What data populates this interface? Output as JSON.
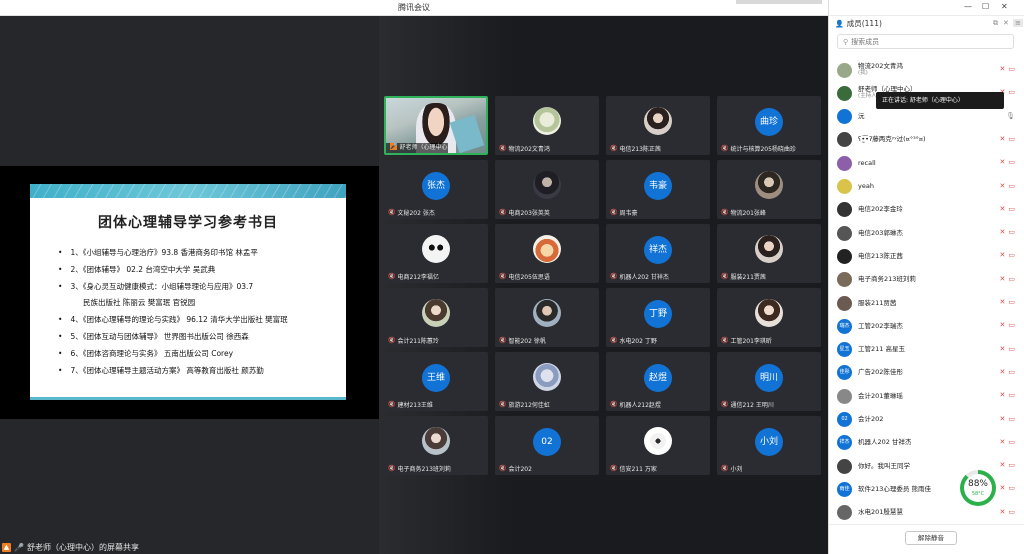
{
  "window": {
    "title": "腾讯会议"
  },
  "share": {
    "slide": {
      "title": "团体心理辅导学习参考书目",
      "items": [
        {
          "text": "1、《小组辅导与心理治疗》93.8 香港商务印书馆 林孟平"
        },
        {
          "text": "2、《团体辅导》 02.2 台湾空中大学 吴武典"
        },
        {
          "text": "3、《身心灵互动健康模式：小组辅导理论与应用》03.7",
          "sub": "民族出版社 陈丽云 樊富珉 官锐园"
        },
        {
          "text": "4、《团体心理辅导的理论与实践》 96.12 清华大学出版社 樊富珉"
        },
        {
          "text": "5、《团体互动与团体辅导》 世界图书出版公司 徐西森"
        },
        {
          "text": "6、《团体咨商理论与实务》 五南出版公司 Corey"
        },
        {
          "text": "7、《团体心理辅导主题活动方案》 高等教育出版社 颜苏勤"
        }
      ]
    },
    "status_text": "舒老师（心理中心）的屏幕共享"
  },
  "tiles": [
    {
      "name": "舒老师（心理中心）",
      "type": "video",
      "active": true
    },
    {
      "name": "物流202文青鸿",
      "type": "image",
      "avatar": "plant"
    },
    {
      "name": "电信213陈正茜",
      "type": "image",
      "avatar": "girl"
    },
    {
      "name": "统计与核算205杨晓曲珍",
      "type": "circle",
      "avatar_text": "曲珍"
    },
    {
      "name": "文秘202 张杰",
      "type": "circle",
      "avatar_text": "张杰"
    },
    {
      "name": "电商203张英英",
      "type": "image",
      "avatar": "dark"
    },
    {
      "name": "周韦豪",
      "type": "circle",
      "avatar_text": "韦豪"
    },
    {
      "name": "物流201张峰",
      "type": "image",
      "avatar": "person"
    },
    {
      "name": "电商212李福亿",
      "type": "image",
      "avatar": "panda"
    },
    {
      "name": "电信205伍思语",
      "type": "image",
      "avatar": "lion"
    },
    {
      "name": "机器人202 甘祥杰",
      "type": "circle",
      "avatar_text": "祥杰"
    },
    {
      "name": "服装211贾茜",
      "type": "image",
      "avatar": "girl"
    },
    {
      "name": "会计211陈蕙玲",
      "type": "image",
      "avatar": "girl2"
    },
    {
      "name": "智能202 徐帆",
      "type": "image",
      "avatar": "boy"
    },
    {
      "name": "水电202 丁野",
      "type": "circle",
      "avatar_text": "丁野"
    },
    {
      "name": "工管201李琪昕",
      "type": "image",
      "avatar": "girl3"
    },
    {
      "name": "建材213王维",
      "type": "circle",
      "avatar_text": "王维"
    },
    {
      "name": "旅游212何佳虹",
      "type": "image",
      "avatar": "anime"
    },
    {
      "name": "机器人212赵煜",
      "type": "circle",
      "avatar_text": "赵煜"
    },
    {
      "name": "通信212 王明川",
      "type": "circle",
      "avatar_text": "明川"
    },
    {
      "name": "电子商务213班刘莉",
      "type": "image",
      "avatar": "girl4"
    },
    {
      "name": "会计202",
      "type": "circle",
      "avatar_text": "02"
    },
    {
      "name": "信安211 万家",
      "type": "image",
      "avatar": "flower"
    },
    {
      "name": "小刘",
      "type": "circle",
      "avatar_text": "小刘"
    }
  ],
  "panel": {
    "title": "成员(111)",
    "search_placeholder": "搜索成员",
    "tooltip": "正在讲话: 舒老师（心理中心）",
    "unmute_label": "解除静音",
    "members": [
      {
        "name": "物流202文青鸿",
        "role": "(我)",
        "av": "img",
        "color": "#9aa88a"
      },
      {
        "name": "舒老师（心理中心）",
        "role": "(主持人)",
        "av": "img",
        "color": "#3a6b3a"
      },
      {
        "name": "沅",
        "av": "txt",
        "av_text": "",
        "color": "#1273d6",
        "mic_on": true
      },
      {
        "name": "ʕ•̫͡•ʔ藤两克ʸʸ过(¤°³°¤)",
        "av": "img",
        "color": "#444"
      },
      {
        "name": "recall",
        "av": "img",
        "color": "#8e5fa8"
      },
      {
        "name": "yeah",
        "av": "img",
        "color": "#d9c34a"
      },
      {
        "name": "电信202李金玲",
        "av": "img",
        "color": "#333"
      },
      {
        "name": "电信203郭琳杰",
        "av": "img",
        "color": "#555"
      },
      {
        "name": "电信213陈正茜",
        "av": "img",
        "color": "#222"
      },
      {
        "name": "电子商务213班刘莉",
        "av": "img",
        "color": "#7a6a5a"
      },
      {
        "name": "服装211贾茜",
        "av": "img",
        "color": "#6a5a50"
      },
      {
        "name": "工管202李瑞杰",
        "av": "txt",
        "av_text": "瑞杰",
        "color": "#1273d6"
      },
      {
        "name": "工管211 高星玉",
        "av": "txt",
        "av_text": "星玉",
        "color": "#1273d6"
      },
      {
        "name": "广告202陈佳彤",
        "av": "txt",
        "av_text": "佳彤",
        "color": "#1273d6"
      },
      {
        "name": "会计201董琳瑶",
        "av": "img",
        "color": "#888"
      },
      {
        "name": "会计202",
        "av": "txt",
        "av_text": "02",
        "color": "#1273d6"
      },
      {
        "name": "机器人202 甘祥杰",
        "av": "txt",
        "av_text": "祥杰",
        "color": "#1273d6"
      },
      {
        "name": "你好。我叫王同学",
        "av": "img",
        "color": "#444"
      },
      {
        "name": "软件213心理委员 熊雨佳",
        "av": "txt",
        "av_text": "雨佳",
        "color": "#1273d6"
      },
      {
        "name": "水电201殷慧慧",
        "av": "img",
        "color": "#666"
      }
    ]
  },
  "gauge": {
    "value": 88,
    "percent_label": "88%",
    "temp": "58°C"
  }
}
